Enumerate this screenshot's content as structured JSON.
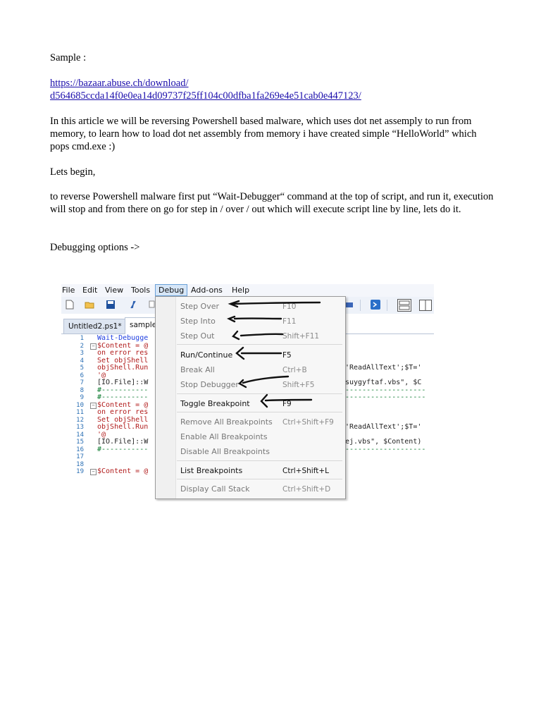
{
  "doc": {
    "sample_label": "Sample :",
    "link_line1": "https://bazaar.abuse.ch/download/",
    "link_line2": "d564685ccda14f0e0ea14d09737f25ff104c00dfba1fa269e4e51cab0e447123/",
    "para1": "In this article we will be reversing Powershell based malware, which uses dot net assemply to run from memory, to learn how to load dot net assembly from memory i have created simple “HelloWorld” which pops cmd.exe :)",
    "para2": "Lets begin,",
    "para3": "to reverse Powershell malware first put “Wait-Debugger“ command at the top of script, and run it, execution will stop and from there on go for step in / over / out  which will execute script line by line, lets do it.",
    "para4": "Debugging options ->"
  },
  "ise": {
    "menu": [
      "File",
      "Edit",
      "View",
      "Tools",
      "Debug",
      "Add-ons",
      "Help"
    ],
    "tabs": [
      "Untitled2.ps1*",
      "sample"
    ],
    "code_lines": [
      {
        "n": "1",
        "text": "Wait-Debugge",
        "color": "blue"
      },
      {
        "n": "2",
        "text": "$Content = @",
        "color": "red",
        "fold": true
      },
      {
        "n": "3",
        "text": "on error res",
        "color": "red"
      },
      {
        "n": "4",
        "text": "Set objShell",
        "color": "red"
      },
      {
        "n": "5",
        "text": "objShell.Run",
        "color": "red",
        "tail": "'ReadAllText';$T='"
      },
      {
        "n": "6",
        "text": "'@",
        "color": "red"
      },
      {
        "n": "7",
        "text": "[IO.File]::W",
        "color": "dark",
        "tail": "suygyftaf.vbs\", $C"
      },
      {
        "n": "8",
        "text": "#-----------",
        "color": "green",
        "dashes": true
      },
      {
        "n": "9",
        "text": "#-----------",
        "color": "green",
        "dashes": true
      },
      {
        "n": "10",
        "text": "$Content = @",
        "color": "red",
        "fold": true
      },
      {
        "n": "11",
        "text": "on error res",
        "color": "red"
      },
      {
        "n": "12",
        "text": "Set objShell",
        "color": "red"
      },
      {
        "n": "13",
        "text": "objShell.Run",
        "color": "red",
        "tail": "'ReadAllText';$T='"
      },
      {
        "n": "14",
        "text": "'@",
        "color": "red"
      },
      {
        "n": "15",
        "text": "[IO.File]::W",
        "color": "dark",
        "tail": "ej.vbs\", $Content)"
      },
      {
        "n": "16",
        "text": "#-----------",
        "color": "green",
        "dashes": true
      },
      {
        "n": "17",
        "text": "",
        "color": "dark"
      },
      {
        "n": "18",
        "text": "",
        "color": "dark"
      },
      {
        "n": "19",
        "text": "$Content = @",
        "color": "red",
        "fold": true
      }
    ],
    "debug_menu": [
      {
        "label": "Step Over",
        "key": "F10",
        "enabled": false
      },
      {
        "label": "Step Into",
        "key": "F11",
        "enabled": false
      },
      {
        "label": "Step Out",
        "key": "Shift+F11",
        "enabled": false
      },
      {
        "label": "Run/Continue",
        "key": "F5",
        "enabled": true
      },
      {
        "label": "Break All",
        "key": "Ctrl+B",
        "enabled": false
      },
      {
        "label": "Stop Debugger",
        "key": "Shift+F5",
        "enabled": false
      },
      {
        "label": "Toggle Breakpoint",
        "key": "F9",
        "enabled": true
      },
      {
        "label": "Remove All Breakpoints",
        "key": "Ctrl+Shift+F9",
        "enabled": false
      },
      {
        "label": "Enable All Breakpoints",
        "key": "",
        "enabled": false
      },
      {
        "label": "Disable All Breakpoints",
        "key": "",
        "enabled": false
      },
      {
        "label": "List Breakpoints",
        "key": "Ctrl+Shift+L",
        "enabled": true
      },
      {
        "label": "Display Call Stack",
        "key": "Ctrl+Shift+D",
        "enabled": false
      }
    ]
  }
}
